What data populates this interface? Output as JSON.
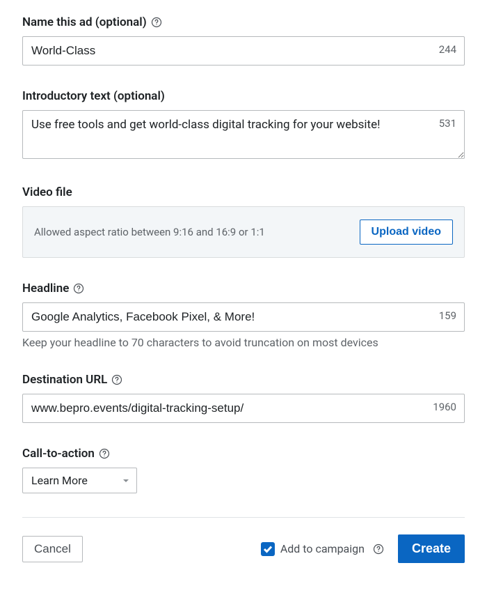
{
  "name_ad": {
    "label": "Name this ad (optional)",
    "value": "World-Class",
    "counter": "244"
  },
  "intro_text": {
    "label": "Introductory text (optional)",
    "value": "Use free tools and get world-class digital tracking for your website!",
    "counter": "531"
  },
  "video_file": {
    "label": "Video file",
    "hint": "Allowed aspect ratio between 9:16 and 16:9 or 1:1",
    "button": "Upload video"
  },
  "headline": {
    "label": "Headline",
    "value": "Google Analytics, Facebook Pixel, & More!",
    "counter": "159",
    "hint": "Keep your headline to 70 characters to avoid truncation on most devices"
  },
  "destination_url": {
    "label": "Destination URL",
    "value": "www.bepro.events/digital-tracking-setup/",
    "counter": "1960"
  },
  "cta": {
    "label": "Call-to-action",
    "selected": "Learn More"
  },
  "footer": {
    "cancel": "Cancel",
    "add_to_campaign": "Add to campaign",
    "create": "Create"
  }
}
